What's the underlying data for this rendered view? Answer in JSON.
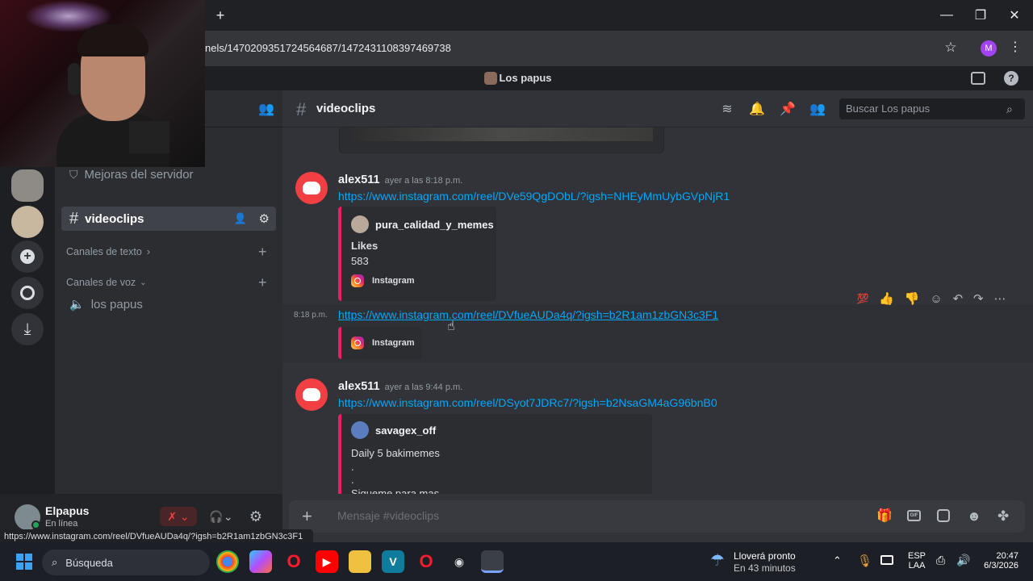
{
  "browser": {
    "url": "nels/1470209351724564687/1472431108397469738",
    "new_tab": "+",
    "minimize": "—",
    "maximize": "❐",
    "close": "✕",
    "profile_initial": "M"
  },
  "discord": {
    "server_title": "Los papus",
    "sidebar": {
      "boost": "Mejoras del servidor",
      "selected_channel": "videoclips",
      "category_text": "Canales de texto",
      "category_voice": "Canales de voz",
      "voice_channel": "los papus"
    },
    "header": {
      "channel": "videoclips",
      "search_placeholder": "Buscar Los papus"
    },
    "messages": [
      {
        "author": "alex511",
        "timestamp": "ayer a las 8:18 p.m.",
        "link": "https://www.instagram.com/reel/DVe59QgDObL/?igsh=NHEyMmUybGVpNjR1",
        "embed": {
          "author": "pura_calidad_y_memes",
          "title": "Likes",
          "value": "583",
          "footer": "Instagram"
        }
      },
      {
        "time": "8:18 p.m.",
        "link": "https://www.instagram.com/reel/DVfueAUDa4q/?igsh=b2R1am1zbGN3c3F1",
        "embed_footer": "Instagram"
      },
      {
        "author": "alex511",
        "timestamp": "ayer a las 9:44 p.m.",
        "link": "https://www.instagram.com/reel/DSyot7JDRc7/?igsh=b2NsaGM4aG96bnB0",
        "embed": {
          "author": "savagex_off",
          "line1": "Daily 5 bakimemes",
          "line2": ".",
          "line3": ".",
          "line4": "Sigueme para mas"
        }
      }
    ],
    "composer_placeholder": "Mensaje #videoclips",
    "user": {
      "name": "Elpapus",
      "status": "En línea"
    },
    "hover_url": "https://www.instagram.com/reel/DVfueAUDa4q/?igsh=b2R1am1zbGN3c3F1"
  },
  "taskbar": {
    "search": "Búsqueda",
    "weather_line1": "Lloverá pronto",
    "weather_line2": "En 43 minutos",
    "lang1": "ESP",
    "lang2": "LAA",
    "time": "20:47",
    "date": "6/3/2026"
  },
  "colors": {
    "accent_link": "#00a8fc",
    "embed_border": "#e91e63",
    "discord_red": "#f23f43"
  }
}
